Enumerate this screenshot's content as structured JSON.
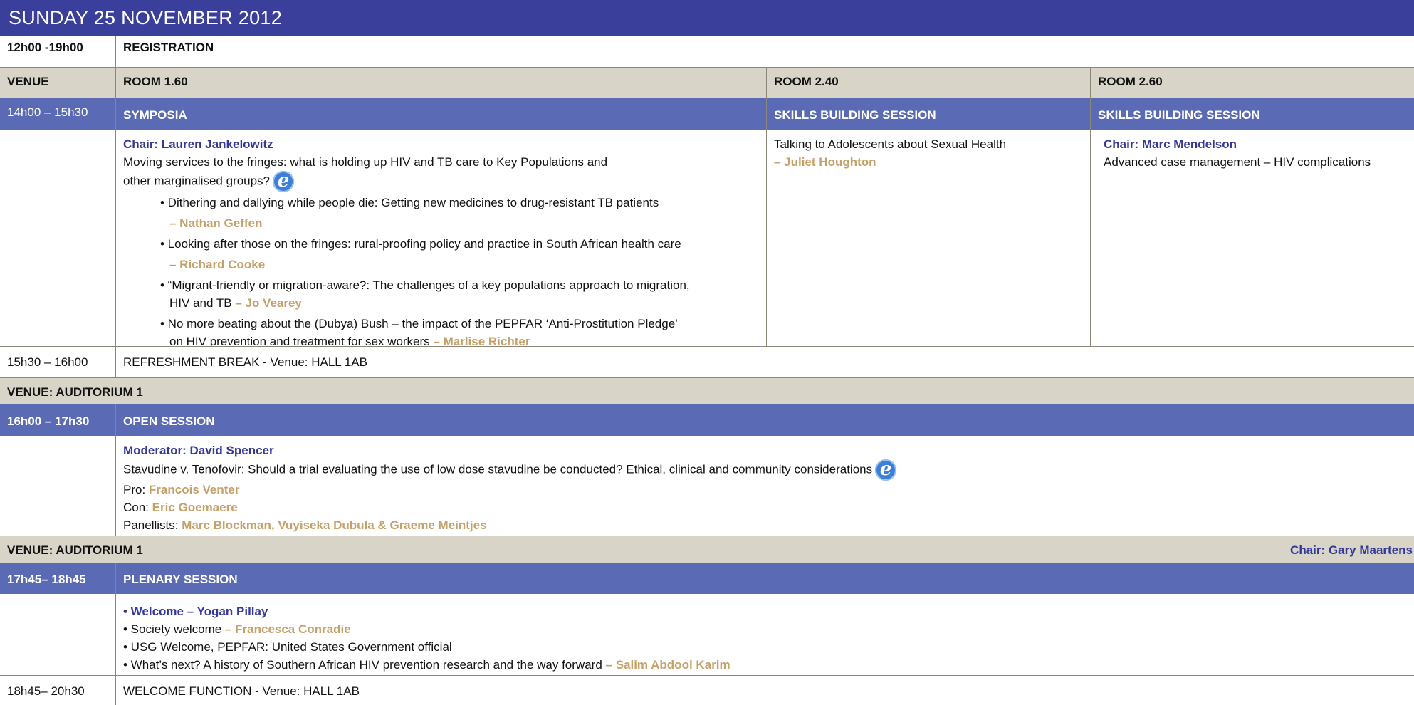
{
  "header": {
    "date": "SUNDAY 25 NOVEMBER 2012"
  },
  "registration": {
    "time": "12h00 -19h00",
    "label": "REGISTRATION"
  },
  "venue_header": {
    "label": "VENUE",
    "room1": "ROOM 1.60",
    "room2": "ROOM 2.40",
    "room3": "ROOM 2.60"
  },
  "session1": {
    "time": "14h00 – 15h30",
    "col1": "SYMPOSIA",
    "col2": "SKILLS BUILDING  SESSION",
    "col3": "SKILLS BUILDING  SESSION"
  },
  "symposia": {
    "chair": "Chair: Lauren Jankelowitz",
    "title_line1": "Moving services to the fringes: what is holding up HIV and TB care to Key Populations and",
    "title_line2": "other marginalised groups?",
    "items": [
      {
        "text": "• Dithering and dallying while people die: Getting new medicines to drug-resistant TB patients",
        "speaker": "– Nathan Geffen"
      },
      {
        "text": "• Looking after those on the fringes: rural-proofing policy and practice in South African health care",
        "speaker": "– Richard Cooke"
      },
      {
        "text1": "• “Migrant-friendly or migration-aware?: The challenges of a key populations approach to migration,",
        "text2": "HIV and TB",
        "speaker": "– Jo Vearey"
      },
      {
        "text1": "• No more beating about the (Dubya) Bush – the impact of the PEPFAR ‘Anti-Prostitution Pledge’",
        "text2": "on HIV prevention and treatment for sex workers",
        "speaker": "– Marlise Richter"
      }
    ]
  },
  "room240": {
    "title": "Talking to Adolescents about Sexual Health",
    "speaker": "– Juliet Houghton"
  },
  "room260": {
    "chair": "Chair: Marc Mendelson",
    "title": "Advanced case management – HIV complications"
  },
  "break1": {
    "time": "15h30 – 16h00",
    "label": "REFRESHMENT BREAK - Venue: HALL 1AB"
  },
  "venue_aud1": {
    "label": "VENUE:  AUDITORIUM 1"
  },
  "open_session": {
    "time": "16h00 – 17h30",
    "label": "OPEN SESSION",
    "moderator": "Moderator: David Spencer",
    "title": "Stavudine v. Tenofovir: Should a trial evaluating the use of low dose stavudine be conducted? Ethical, clinical and community considerations",
    "pro_label": "Pro:",
    "pro": "Francois Venter",
    "con_label": "Con:",
    "con": "Eric Goemaere",
    "panel_label": "Panellists:",
    "panel": "Marc Blockman, Vuyiseka Dubula & Graeme Meintjes"
  },
  "venue_aud1b": {
    "label": "VENUE:  AUDITORIUM 1",
    "chair": "Chair: Gary Maartens"
  },
  "plenary": {
    "time": "17h45– 18h45",
    "label": "PLENARY SESSION",
    "welcome": "• Welcome – Yogan Pillay",
    "society": "• Society welcome",
    "society_speaker": "– Francesca Conradie",
    "usg": "• USG Welcome, PEPFAR: United States Government official",
    "next": "• What’s next? A history of Southern African HIV prevention research and the way forward",
    "next_speaker": "– Salim Abdool Karim"
  },
  "welcome_function": {
    "time": "18h45– 20h30",
    "label": "WELCOME FUNCTION - Venue: HALL 1AB"
  },
  "icons": {
    "e_icon": "e-learning-icon",
    "e_char": "e"
  }
}
